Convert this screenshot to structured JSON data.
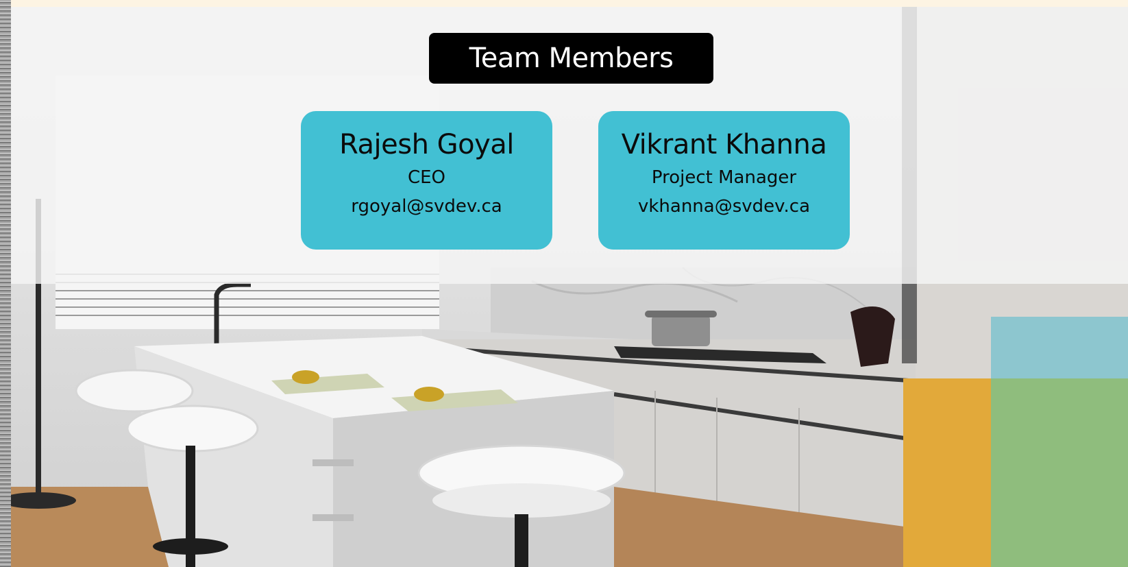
{
  "title": "Team Members",
  "members": [
    {
      "name": "Rajesh Goyal",
      "role": "CEO",
      "email": "rgoyal@svdev.ca"
    },
    {
      "name": "Vikrant Khanna",
      "role": "Project Manager",
      "email": "vkhanna@svdev.ca"
    }
  ],
  "colors": {
    "card": "#42c0d3",
    "title_bg": "#000000",
    "accent_yellow": "#e2a93a",
    "accent_blue": "#7fc3cf",
    "accent_green": "#8fbd7d"
  }
}
